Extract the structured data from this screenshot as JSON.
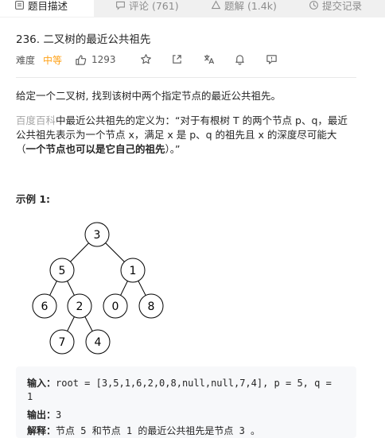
{
  "tabs": [
    {
      "label": "题目描述",
      "icon": "description-icon",
      "active": true
    },
    {
      "label": "评论 (761)",
      "icon": "comment-icon",
      "active": false
    },
    {
      "label": "题解 (1.4k)",
      "icon": "solution-icon",
      "active": false
    },
    {
      "label": "提交记录",
      "icon": "history-icon",
      "active": false
    }
  ],
  "problem": {
    "title": "236. 二叉树的最近公共祖先",
    "difficulty_label": "难度",
    "difficulty": "中等",
    "likes": "1293",
    "difficulty_color": "#ffa116"
  },
  "description": {
    "intro": "给定一个二叉树, 找到该树中两个指定节点的最近公共祖先。",
    "baike_link": "百度百科",
    "def_line1": "中最近公共祖先的定义为：“对于有根树 T 的两个节点 p、q，最近",
    "def_line2": "公共祖先表示为一个节点 x，满足 x 是 p、q 的祖先且 x 的深度尽可能大",
    "def_line3_open": "（",
    "def_line3_bold": "一个节点也可以是它自己的祖先",
    "def_line3_close": "）。”"
  },
  "example": {
    "title": "示例 1:",
    "tree_nodes": [
      "3",
      "5",
      "1",
      "6",
      "2",
      "0",
      "8",
      "7",
      "4"
    ],
    "input_label": "输入：",
    "input_value": "root = [3,5,1,6,2,0,8,null,null,7,4], p = 5, q =",
    "input_value_cont": "1",
    "output_label": "输出：",
    "output_value": "3",
    "explain_label": "解释：",
    "explain_value": "节点 5 和节点 1 的最近公共祖先是节点 3 。"
  }
}
